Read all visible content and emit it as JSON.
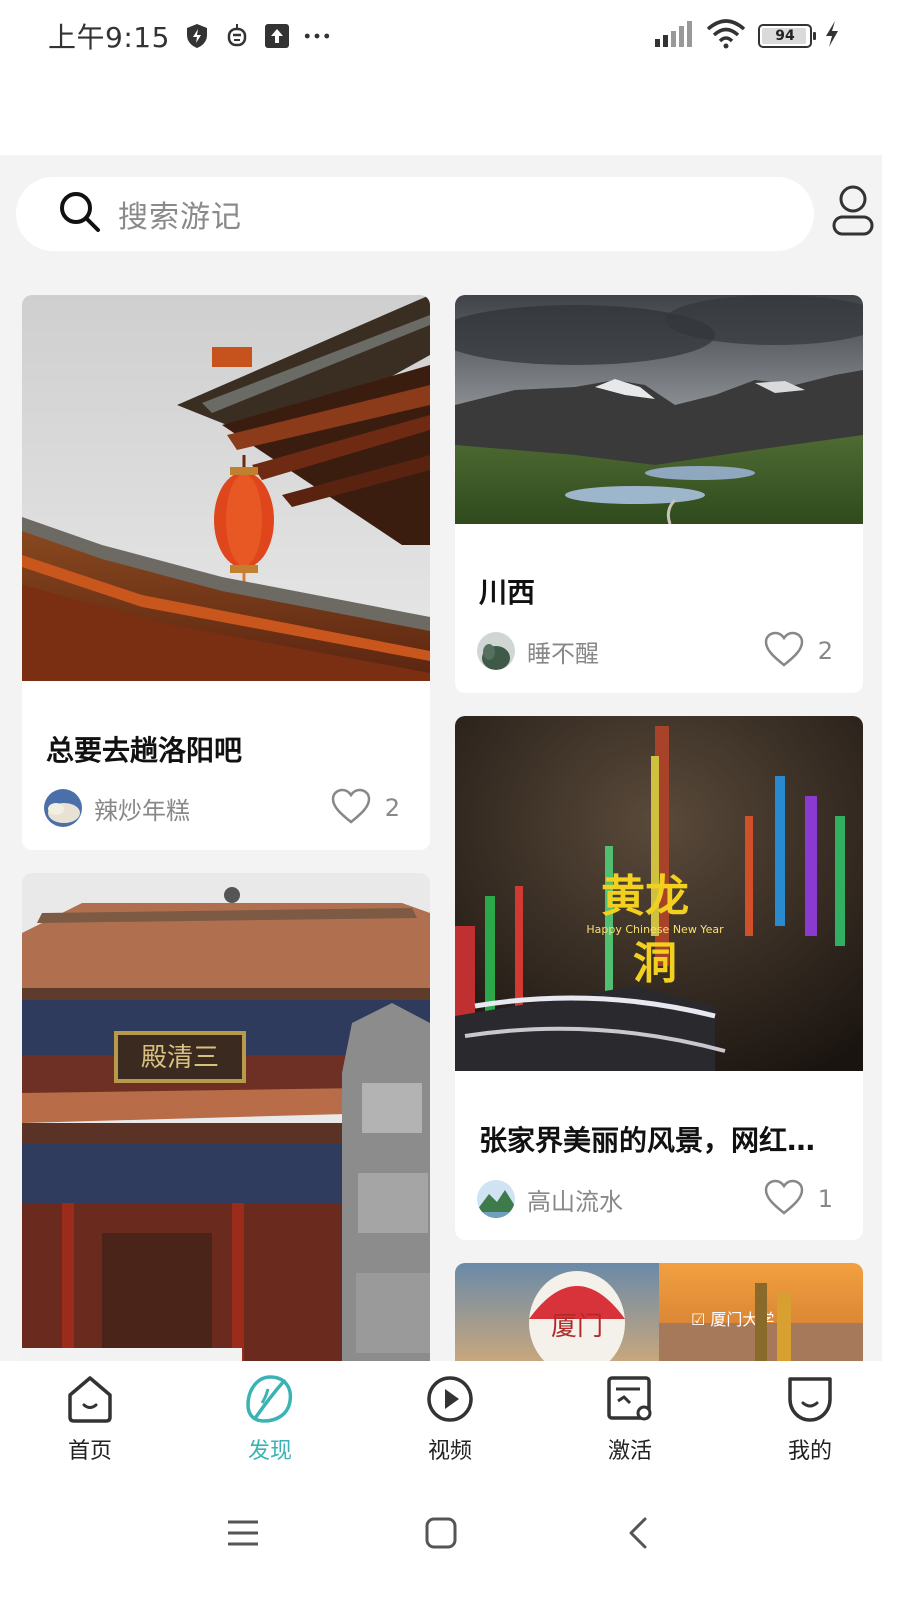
{
  "status_bar": {
    "time": "上午9:15",
    "battery_percent": "94",
    "icons": [
      "shield-icon",
      "robot-icon",
      "upload-icon",
      "more-dots-icon",
      "signal-icon",
      "wifi-icon",
      "battery-icon",
      "charging-icon"
    ]
  },
  "search": {
    "placeholder": "搜索游记",
    "icon": "search-icon"
  },
  "profile_icon": "user-icon",
  "cards": [
    {
      "title": "总要去趟洛阳吧",
      "author": "辣炒年糕",
      "likes": "2",
      "image": "luoyang-temple-lantern-photo"
    },
    {
      "title": "川西",
      "author": "睡不醒",
      "likes": "2",
      "image": "mountain-lake-photo"
    },
    {
      "title": "",
      "author": "",
      "likes": "",
      "image": "sanqing-hall-photo",
      "sign_text": "殿清三"
    },
    {
      "title": "张家界美丽的风景，网红…",
      "author": "高山流水",
      "likes": "1",
      "image": "huanglong-cave-photo",
      "overlay_line1": "黄龙",
      "overlay_sub": "Happy Chinese New Year",
      "overlay_line2": "洞"
    },
    {
      "title": "",
      "author": "",
      "likes": "",
      "image": "xiamen-balloon-beach-photo",
      "balloon_text": "厦门",
      "tag_text": "☑ 厦门大学"
    }
  ],
  "bottom_nav": [
    {
      "label": "首页",
      "icon": "home-icon",
      "active": false
    },
    {
      "label": "发现",
      "icon": "discover-leaf-icon",
      "active": true
    },
    {
      "label": "视频",
      "icon": "play-icon",
      "active": false
    },
    {
      "label": "激活",
      "icon": "activate-icon",
      "active": false
    },
    {
      "label": "我的",
      "icon": "mine-icon",
      "active": false
    }
  ],
  "system_nav": [
    "menu-icon",
    "home-square-icon",
    "back-icon"
  ],
  "colors": {
    "accent": "#3bb3b4",
    "background": "#f3f3f3"
  }
}
